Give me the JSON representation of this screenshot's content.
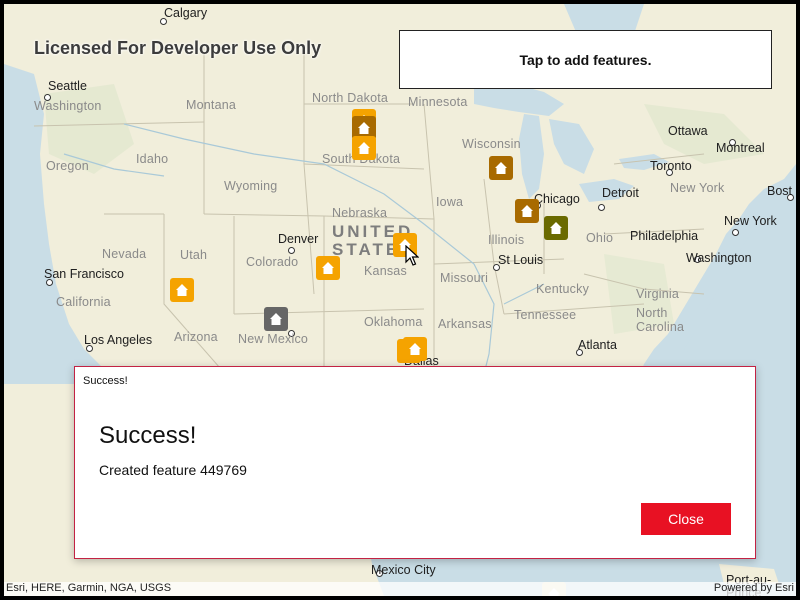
{
  "app": {
    "license_text": "Licensed For Developer Use Only",
    "instructions": "Tap to add features."
  },
  "map": {
    "labels": {
      "calgary": "Calgary",
      "seattle": "Seattle",
      "washington_state": "Washington",
      "montana": "Montana",
      "north_dakota": "North Dakota",
      "minnesota": "Minnesota",
      "oregon": "Oregon",
      "idaho": "Idaho",
      "wyoming": "Wyoming",
      "south_dakota": "South Dakota",
      "wisconsin": "Wisconsin",
      "ottawa": "Ottawa",
      "montreal": "Montreal",
      "toronto": "Toronto",
      "boston": "Bost",
      "new_york_state": "New York",
      "new_york": "New York",
      "detroit": "Detroit",
      "chicago": "Chicago",
      "iowa": "Iowa",
      "nebraska": "Nebraska",
      "united_states": "UNITED STATES",
      "denver": "Denver",
      "utah": "Utah",
      "nevada": "Nevada",
      "colorado": "Colorado",
      "kansas": "Kansas",
      "illinois": "Illinois",
      "ohio": "Ohio",
      "philadelphia": "Philadelphia",
      "washington_dc": "Washington",
      "san_francisco": "San Francisco",
      "missouri": "Missouri",
      "st_louis": "St Louis",
      "kentucky": "Kentucky",
      "virginia": "Virginia",
      "california": "California",
      "tennessee": "Tennessee",
      "north_carolina": "North Carolina",
      "oklahoma": "Oklahoma",
      "arkansas": "Arkansas",
      "los_angeles": "Los Angeles",
      "arizona": "Arizona",
      "new_mexico": "New Mexico",
      "atlanta": "Atlanta",
      "dallas": "Dallas",
      "mexico_city": "Mexico City",
      "port_au_prince": "Port-au-Prince"
    },
    "colors": {
      "water": "#c9dde6",
      "land": "#f1eedb",
      "marker_orange": "#f5a300",
      "marker_brown": "#a86a00",
      "marker_olive": "#6a6a00",
      "marker_gray": "#666666"
    },
    "marker_icon": "home-icon"
  },
  "dialog": {
    "title": "Success!",
    "heading": "Success!",
    "message": "Created feature 449769",
    "close_label": "Close",
    "accent_color": "#e81123"
  },
  "attribution": {
    "left": "Esri, HERE, Garmin, NGA, USGS",
    "right": "Powered by Esri"
  }
}
